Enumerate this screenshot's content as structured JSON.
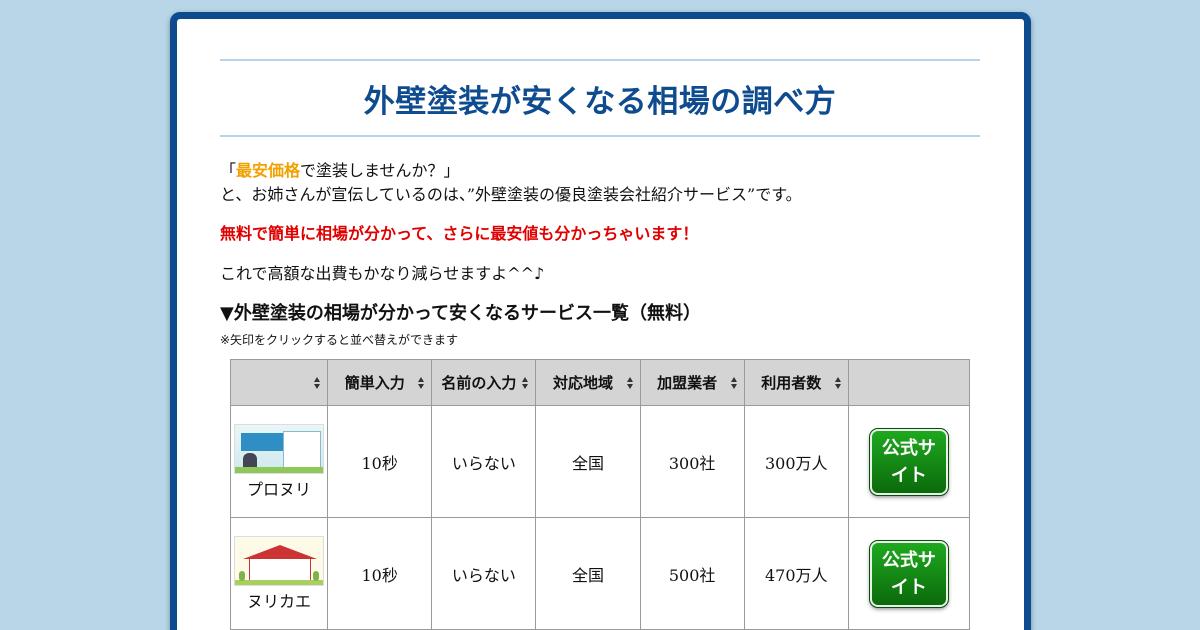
{
  "page": {
    "title": "外壁塗装が安くなる相場の調べ方",
    "intro_line1_prefix": "「",
    "intro_highlight": "最安価格",
    "intro_line1_suffix": "で塗装しませんか？」",
    "intro_line2": "と、お姉さんが宣伝しているのは、”外壁塗装の優良塗装会社紹介サービス”です。",
    "red_note": "無料で簡単に相場が分かって、さらに最安値も分かっちゃいます！",
    "line3": "これで高額な出費もかなり減らせますよ^^♪",
    "section_heading": "▼外壁塗装の相場が分かって安くなるサービス一覧（無料）",
    "sort_note": "※矢印をクリックすると並べ替えができます"
  },
  "colors": {
    "background": "#b8d6e8",
    "frame": "#0e4a8e",
    "title": "#0f4c8f",
    "highlight": "#f2a100",
    "red_note": "#e00000",
    "button": "#148c14"
  },
  "table": {
    "headers": [
      "",
      "簡単入力",
      "名前の入力",
      "対応地域",
      "加盟業者",
      "利用者数",
      ""
    ],
    "rows": [
      {
        "name": "プロヌリ",
        "input_time": "10秒",
        "name_input": "いらない",
        "area": "全国",
        "members": "300社",
        "users": "300万人",
        "button": "公式サイト"
      },
      {
        "name": "ヌリカエ",
        "input_time": "10秒",
        "name_input": "いらない",
        "area": "全国",
        "members": "500社",
        "users": "470万人",
        "button": "公式サイト"
      }
    ]
  }
}
